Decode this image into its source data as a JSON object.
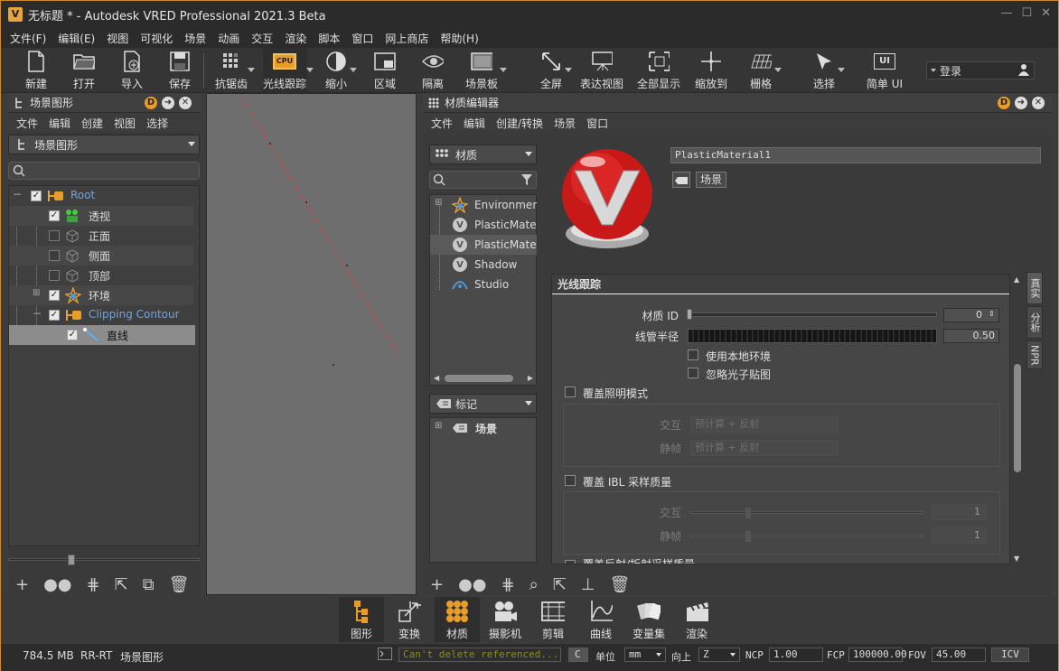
{
  "window": {
    "title": "无标题 * - Autodesk VRED Professional 2021.3 Beta",
    "logo": "V"
  },
  "menu": [
    "文件(F)",
    "编辑(E)",
    "视图",
    "可视化",
    "场景",
    "动画",
    "交互",
    "渲染",
    "脚本",
    "窗口",
    "网上商店",
    "帮助(H)"
  ],
  "toolbar": {
    "new": "新建",
    "open": "打开",
    "import": "导入",
    "save": "保存",
    "antialias": "抗锯齿",
    "raytrace": "光线跟踪",
    "zoom_out": "缩小",
    "region": "区域",
    "isolate": "隔离",
    "scene_plate": "场景板",
    "fullscreen": "全屏",
    "presentation": "表达视图",
    "show_all": "全部显示",
    "zoom_to": "缩放到",
    "grid": "栅格",
    "select": "选择",
    "simple_ui": "简单 UI",
    "cpu": "CPU",
    "ui_icon": "UI",
    "login": "登录"
  },
  "scene": {
    "title": "场景图形",
    "menu": [
      "文件",
      "编辑",
      "创建",
      "视图",
      "选择"
    ],
    "combo": "场景图形",
    "nodes": {
      "root": "Root",
      "perspective": "透视",
      "front": "正面",
      "side": "侧面",
      "top": "顶部",
      "environment": "环境",
      "clipping": "Clipping Contour",
      "line": "直线"
    }
  },
  "material": {
    "title": "材质编辑器",
    "menu": [
      "文件",
      "编辑",
      "创建/转换",
      "场景",
      "窗口"
    ],
    "combo": "材质",
    "list": [
      "Environment",
      "PlasticMater",
      "PlasticMater",
      "Shadow",
      "Studio"
    ],
    "tag_combo": "标记",
    "tag_item": "场景",
    "name": "PlasticMaterial1",
    "scene_tag": "场景",
    "section": "光线跟踪",
    "material_id_label": "材质 ID",
    "material_id_value": "0",
    "tube_label": "线管半径",
    "tube_value": "0.50",
    "use_local_env": "使用本地环境",
    "ignore_photon": "忽略光子贴图",
    "override_light": "覆盖照明模式",
    "interactive": "交互",
    "still": "静帧",
    "precompute_ind": "预计算 + 反射",
    "override_ibl": "覆盖 IBL 采样质量",
    "ibl_int_value": "1",
    "ibl_still_value": "1",
    "override_refl": "覆盖反射/折射采样质量",
    "tabs": [
      "真实",
      "分析",
      "NPR"
    ]
  },
  "dock": [
    "图形",
    "变换",
    "材质",
    "摄影机",
    "剪辑",
    "曲线",
    "变量集",
    "渲染"
  ],
  "status": {
    "memory": "784.5 MB",
    "mode": "RR-RT",
    "context": "场景图形",
    "message": "Can't delete referenced...",
    "c_btn": "C",
    "unit_label": "单位",
    "unit_value": "mm",
    "up_label": "向上",
    "up_value": "Z",
    "ncp_label": "NCP",
    "ncp_value": "1.00",
    "fcp_label": "FCP",
    "fcp_value": "100000.00",
    "fov_label": "FOV",
    "fov_value": "45.00",
    "icv": "ICV"
  }
}
